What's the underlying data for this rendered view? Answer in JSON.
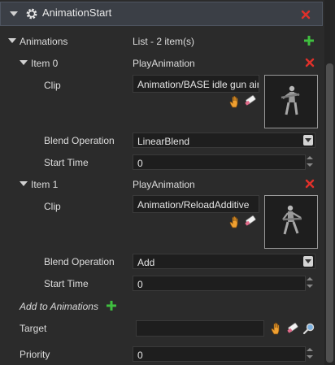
{
  "header": {
    "title": "AnimationStart"
  },
  "animations": {
    "label": "Animations",
    "summary": "List - 2 item(s)",
    "items": [
      {
        "label": "Item 0",
        "type": "PlayAnimation",
        "clip_label": "Clip",
        "clip_value": "Animation/BASE idle gun air",
        "blend_label": "Blend Operation",
        "blend_value": "LinearBlend",
        "start_label": "Start Time",
        "start_value": "0"
      },
      {
        "label": "Item 1",
        "type": "PlayAnimation",
        "clip_label": "Clip",
        "clip_value": "Animation/ReloadAdditive",
        "blend_label": "Blend Operation",
        "blend_value": "Add",
        "start_label": "Start Time",
        "start_value": "0"
      }
    ],
    "add_label": "Add to Animations"
  },
  "target": {
    "label": "Target",
    "value": ""
  },
  "priority": {
    "label": "Priority",
    "value": "0"
  },
  "colors": {
    "accent_red": "#e0302a",
    "accent_green": "#3fbf3f",
    "header_bg": "#3b3f46",
    "panel_bg": "#2b2b2b"
  }
}
